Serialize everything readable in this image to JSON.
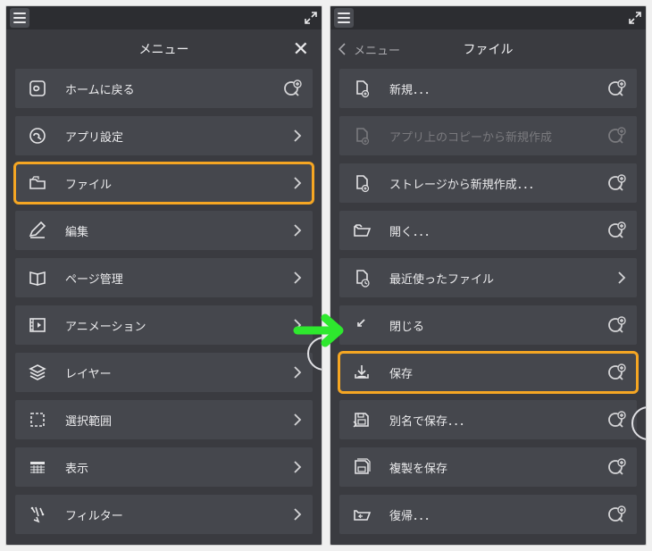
{
  "left": {
    "header_title": "メニュー",
    "items": [
      {
        "label": "ホームに戻る",
        "trail": "toolbar"
      },
      {
        "label": "アプリ設定",
        "trail": "chev"
      },
      {
        "label": "ファイル",
        "trail": "chev",
        "highlight": true
      },
      {
        "label": "編集",
        "trail": "chev"
      },
      {
        "label": "ページ管理",
        "trail": "chev"
      },
      {
        "label": "アニメーション",
        "trail": "chev"
      },
      {
        "label": "レイヤー",
        "trail": "chev"
      },
      {
        "label": "選択範囲",
        "trail": "chev"
      },
      {
        "label": "表示",
        "trail": "chev"
      },
      {
        "label": "フィルター",
        "trail": "chev"
      }
    ]
  },
  "right": {
    "back_label": "メニュー",
    "header_title": "ファイル",
    "items": [
      {
        "label": "新規．．．",
        "trail": "toolbar"
      },
      {
        "label": "アプリ上のコピーから新規作成",
        "trail": "toolbar",
        "disabled": true
      },
      {
        "label": "ストレージから新規作成．．．",
        "trail": "toolbar"
      },
      {
        "label": "開く．．．",
        "trail": "toolbar"
      },
      {
        "label": "最近使ったファイル",
        "trail": "chev"
      },
      {
        "label": "閉じる",
        "trail": "toolbar"
      },
      {
        "label": "保存",
        "trail": "toolbar",
        "highlight": true
      },
      {
        "label": "別名で保存．．．",
        "trail": "toolbar"
      },
      {
        "label": "複製を保存",
        "trail": "toolbar"
      },
      {
        "label": "復帰．．．",
        "trail": "toolbar"
      }
    ]
  }
}
